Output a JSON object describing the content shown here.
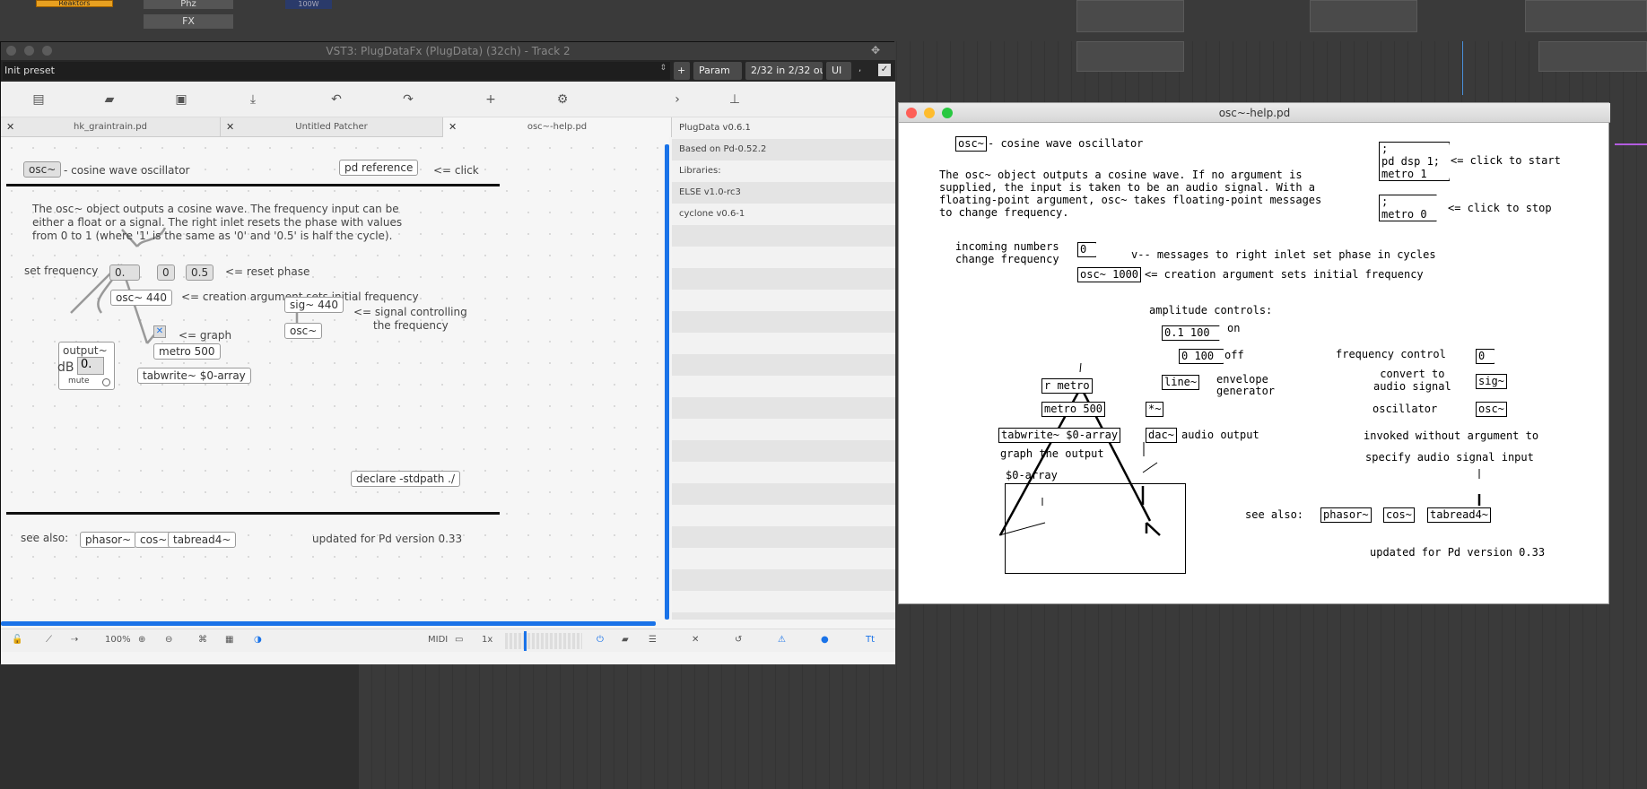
{
  "daw": {
    "chip_label": "Reaktors",
    "phz_label": "Phz",
    "fx_label": "FX",
    "vol_label": "100W"
  },
  "plugin_window": {
    "title": "VST3: PlugDataFx (PlugData) (32ch) - Track 2",
    "preset": "Init preset",
    "buttons": {
      "plus": "+",
      "param": "Param",
      "io": "2/32 in 2/32 out",
      "ui": "UI"
    }
  },
  "tabs": [
    {
      "label": "hk_graintrain.pd"
    },
    {
      "label": "Untitled Patcher"
    },
    {
      "label": "osc~-help.pd"
    }
  ],
  "sidebar": {
    "items": [
      "PlugData v0.6.1",
      "Based on Pd-0.52.2",
      "Libraries:",
      "ELSE v1.0-rc3",
      "cyclone v0.6-1"
    ]
  },
  "patch": {
    "title_obj": "osc~",
    "title_text": "- cosine wave oscillator",
    "ref_obj": "pd reference",
    "ref_note": "<= click",
    "desc_lines": [
      "The osc~ object outputs a cosine wave. The frequency input can be",
      "either a float or a signal. The right inlet resets the phase with values",
      "from 0 to 1 (where '1' is the same as '0' and '0.5' is half the cycle)."
    ],
    "set_freq": "set frequency",
    "num_freq": "0.",
    "msg_0": "0",
    "msg_05": "0.5",
    "reset_phase": "<= reset phase",
    "osc440": "osc~ 440",
    "creation_arg": "<= creation argument sets initial frequency",
    "graph": "<= graph",
    "metro": "metro 500",
    "tabwrite": "tabwrite~ $0-array",
    "output": "output~",
    "db": "dB",
    "db_val": "0.",
    "mute": "mute",
    "sig440": "sig~ 440",
    "osc2": "osc~",
    "sig_note_1": "<= signal controlling",
    "sig_note_2": "the frequency",
    "declare": "declare -stdpath ./",
    "see_also": "see also:",
    "phasor": "phasor~",
    "cos": "cos~",
    "tabread": "tabread4~",
    "updated": "updated for Pd version 0.33"
  },
  "statusbar": {
    "zoom": "100%",
    "midi": "MIDI",
    "speed": "1x"
  },
  "help_window": {
    "title": "osc~-help.pd",
    "osc_obj": "osc~",
    "osc_text": "- cosine wave oscillator",
    "desc": "The osc~ object outputs a cosine wave. If no argument is\nsupplied, the input is taken to be an audio signal. With a\nfloating-point argument, osc~ takes floating-point messages\nto change frequency.",
    "msg_start": ";\npd dsp 1;\nmetro 1",
    "start_note": "<= click to start",
    "msg_stop": ";\nmetro 0",
    "stop_note": "<= click to stop",
    "incoming": "incoming numbers\nchange frequency",
    "num0": "0",
    "phase_note": "v-- messages to right inlet set phase in cycles",
    "osc1000": "osc~ 1000",
    "creation_note": "<= creation argument sets initial frequency",
    "amp_label": "amplitude controls:",
    "msg_on": "0.1 100",
    "on": "on",
    "msg_off": "0 100",
    "off": "off",
    "line": "line~",
    "env": "envelope\ngenerator",
    "mult": "*~",
    "rmetro": "r metro",
    "metro500": "metro 500",
    "tabwrite": "tabwrite~ $0-array",
    "graph_out": "graph the output",
    "dac": "dac~",
    "audio_out": "audio output",
    "array": "$0-array",
    "freq_ctrl": "frequency control",
    "num_b": "0",
    "convert": "convert to\naudio signal",
    "sig": "sig~",
    "oscillator": "oscillator",
    "osc_b": "osc~",
    "invoked": "invoked without argument to",
    "specify": "specify audio signal input",
    "see_also": "see also:",
    "phasor": "phasor~",
    "cos": "cos~",
    "tabread": "tabread4~",
    "updated": "updated for Pd version 0.33"
  }
}
